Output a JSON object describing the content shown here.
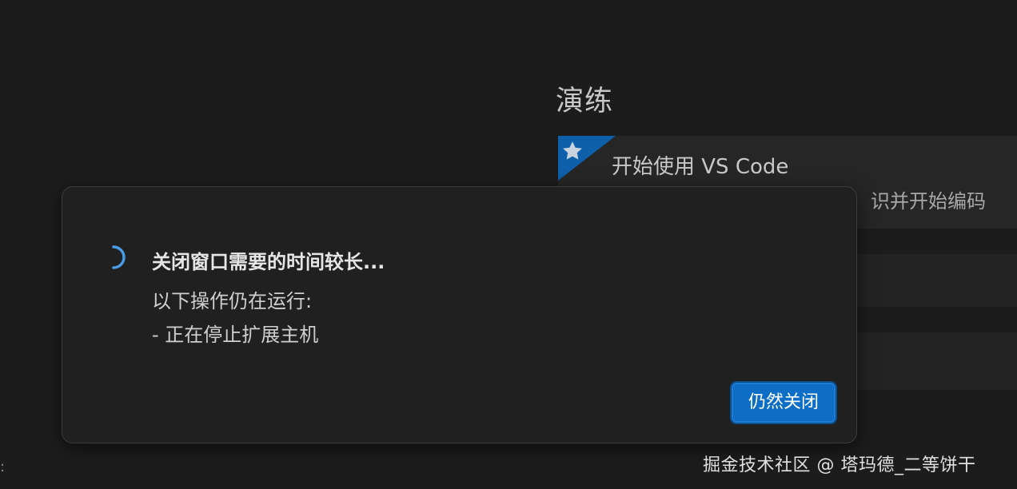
{
  "welcome": {
    "section_heading": "演练",
    "walkthrough_card": {
      "title": "开始使用 VS Code",
      "description_visible": "识并开始编码",
      "badge_icon": "star-icon",
      "badge_color": "#0e60aa"
    }
  },
  "dialog": {
    "title": "关闭窗口需要的时间较长...",
    "detail_lines": [
      "以下操作仍在运行:",
      "- 正在停止扩展主机"
    ],
    "spinner_icon": "loading-spinner-icon",
    "spinner_color": "#4a9be6",
    "close_anyway_label": "仍然关闭",
    "accent_color": "#0e6dc4"
  },
  "left_edge_glyph": ":",
  "watermark": "掘金技术社区 @ 塔玛德_二等饼干"
}
